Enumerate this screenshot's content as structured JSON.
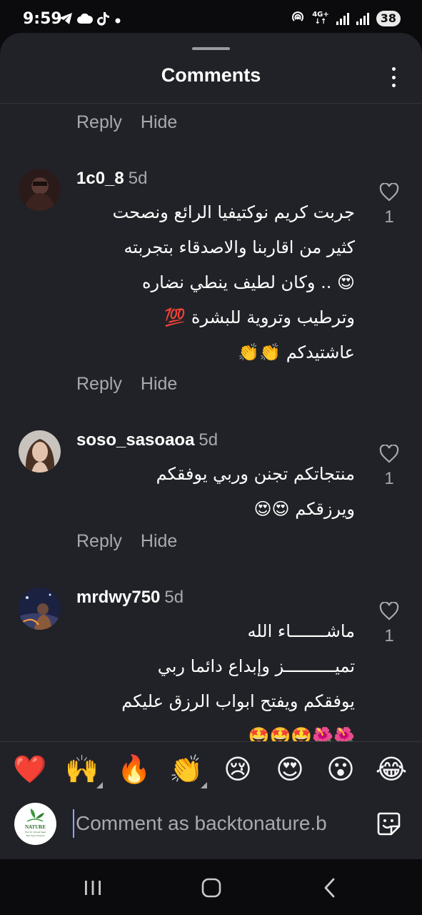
{
  "status_bar": {
    "time": "9:59",
    "battery": "38",
    "network": "4G+",
    "left_icons": [
      "telegram-icon",
      "cloud-icon",
      "tiktok-icon",
      "dot-icon"
    ],
    "right_icons": [
      "hotspot-icon",
      "signal-icon",
      "signal-icon"
    ]
  },
  "sheet": {
    "title": "Comments"
  },
  "first_actions": {
    "reply": "Reply",
    "hide": "Hide"
  },
  "comments": [
    {
      "username": "1c0_8",
      "time": "5d",
      "text": "جربت كريم نوكتيفيا الرائع ونصحت\nكثير من اقاربنا والاصدقاء  بتجربته\n😍 .. وكان لطيف ينطي نضاره\nوترطيب وتروية للبشرة 💯\nعاشتيدكم 👏👏",
      "likes": "1",
      "reply": "Reply",
      "hide": "Hide"
    },
    {
      "username": "soso_sasoaoa",
      "time": "5d",
      "text": "منتجاتكم تجنن وربي يوفقكم\nويرزقكم 😍😍",
      "likes": "1",
      "reply": "Reply",
      "hide": "Hide"
    },
    {
      "username": "mrdwy750",
      "time": "5d",
      "text": "ماشـــــــاء الله\nتميــــــــــز وإبداع دائما ربي\nيوفقكم ويفتح ابواب الرزق عليكم\n🌺🌺🤩🤩🤩",
      "likes": "1"
    }
  ],
  "emoji_bar": [
    "❤️",
    "🙌",
    "🔥",
    "👏",
    "😢",
    "😍",
    "😮",
    "😂"
  ],
  "composer": {
    "placeholder": "Comment as backtonature.b",
    "brand_logo_text": "NATURE",
    "brand_small_text": "Prof. Dr. Ahmed Saad",
    "brand_small_text2": "Skin Care Products"
  },
  "colors": {
    "sheet_bg": "#212227",
    "muted": "#a8a9b0",
    "accent_cursor": "#8fa3ff",
    "reaction_red": "#ff3040"
  }
}
